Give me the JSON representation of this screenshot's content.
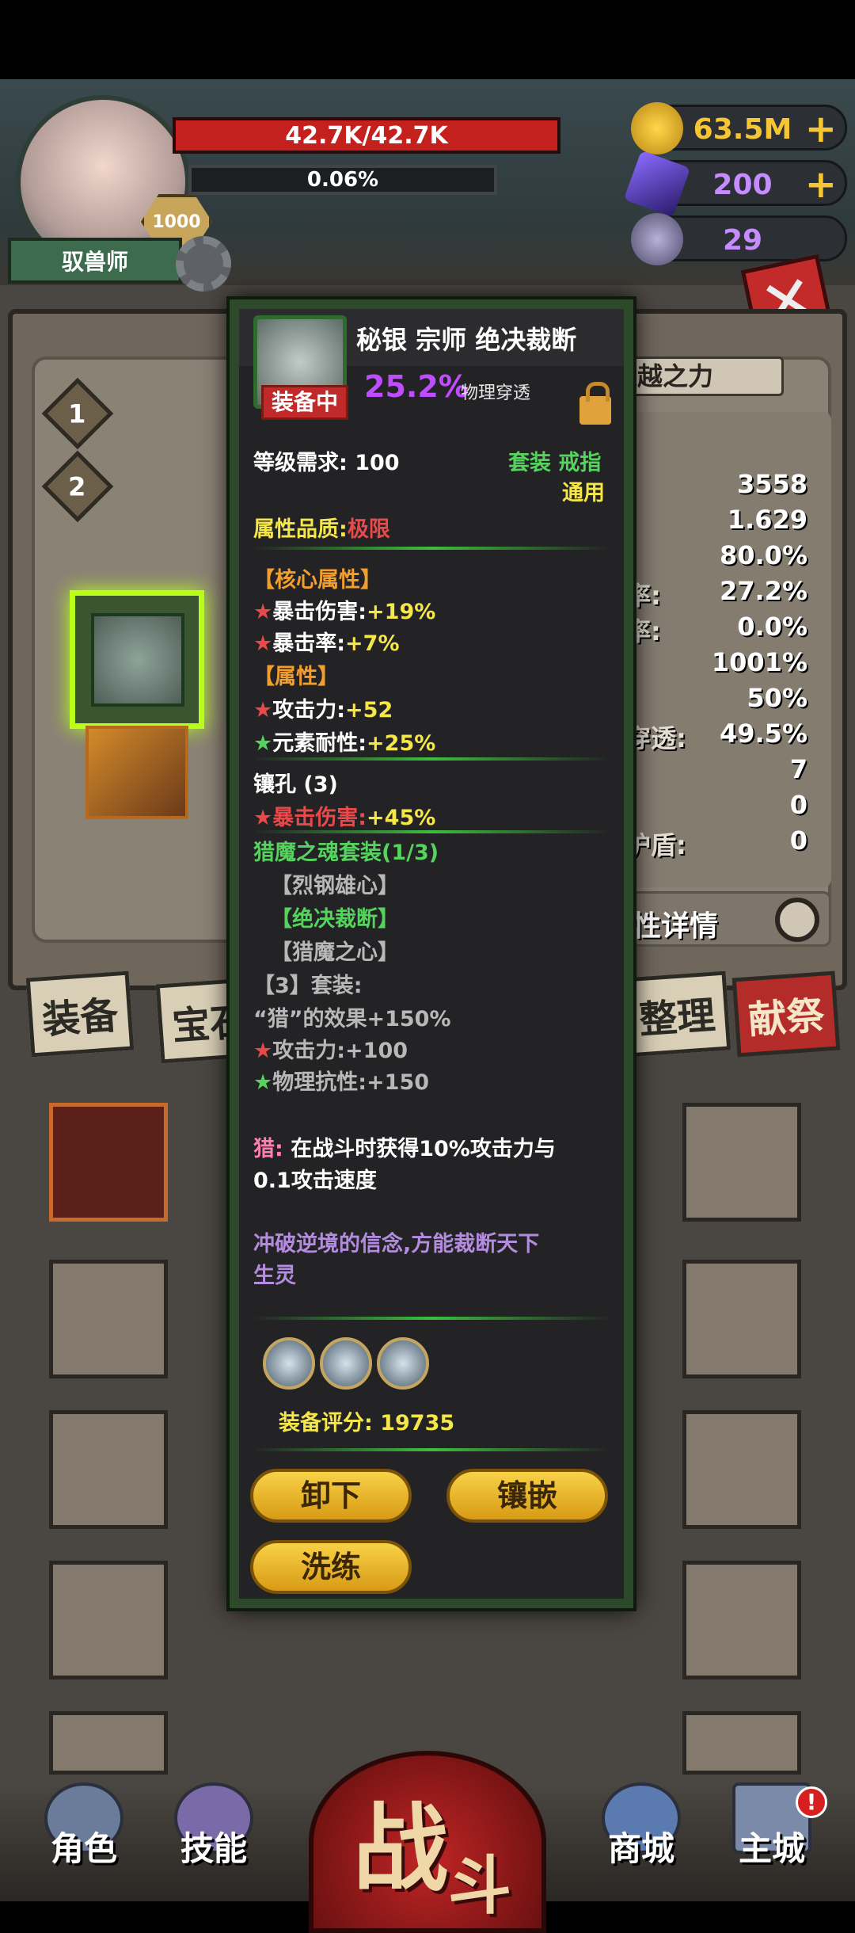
{
  "player": {
    "hp": "42.7K/42.7K",
    "exp": "0.06%",
    "level": "1000",
    "class_name": "驭兽师"
  },
  "resources": {
    "gold": "63.5M",
    "gems": "200",
    "tokens": "29"
  },
  "side_tabs": [
    "1",
    "2"
  ],
  "stats": {
    "header_label": "超越之力",
    "values": [
      "3558",
      "1.629",
      "80.0%",
      "27.2%",
      "0.0%",
      "1001%",
      "50%",
      "49.5%",
      "7",
      "0",
      "0"
    ],
    "partial_labels": [
      "率:",
      "率:",
      "穿透:",
      ":",
      ":",
      "护盾:"
    ],
    "details_button": "属性详情"
  },
  "tabs": {
    "equip": "装备",
    "treasure": "宝石",
    "sort": "整理",
    "sacrifice": "献祭"
  },
  "popup": {
    "title": "秘银 宗师 绝决裁断",
    "equipped_badge": "装备中",
    "percent": "25.2%",
    "percent_label": "物理穿透",
    "level_req_label": "等级需求:",
    "level_req_value": "100",
    "set_type": "套装 戒指",
    "set_usage": "通用",
    "quality_label": "属性品质:",
    "quality_value": "极限",
    "core_header": "【核心属性】",
    "core_1": "暴击伤害:",
    "core_1_val": "+19%",
    "core_2": "暴击率:",
    "core_2_val": "+7%",
    "attr_header": "【属性】",
    "attr_1": "攻击力:",
    "attr_1_val": "+52",
    "attr_2": "元素耐性:",
    "attr_2_val": "+25%",
    "socket_header": "镶孔 (3)",
    "socket_1": "暴击伤害:",
    "socket_1_val": "+45%",
    "set_name": "猎魔之魂套装(1/3)",
    "set_piece_1": "【烈钢雄心】",
    "set_piece_2": "【绝决裁断】",
    "set_piece_3": "【猎魔之心】",
    "set_bonus_header": "【3】套装:",
    "set_bonus_1": "“猎”的效果+150%",
    "set_bonus_2": "攻击力:",
    "set_bonus_2_val": "+100",
    "set_bonus_3": "物理抗性:",
    "set_bonus_3_val": "+150",
    "hunt_label": "猎:",
    "hunt_text_1": "在战斗时获得10%攻击力与",
    "hunt_text_2": "0.1攻击速度",
    "flavor_1": "冲破逆境的信念,方能裁断天下",
    "flavor_2": "生灵",
    "score_label": "装备评分:",
    "score_value": "19735",
    "btn_unequip": "卸下",
    "btn_inlay": "镶嵌",
    "btn_refine": "洗练",
    "star": "★"
  },
  "nav": {
    "role": "角色",
    "skills": "技能",
    "fight_1": "战",
    "fight_2": "斗",
    "shop": "商城",
    "city": "主城",
    "badge": "!"
  },
  "colors": {
    "hp_bar": "#c3201e",
    "quality_red": "#e64a4a",
    "percent_purple": "#c04cff",
    "popup_border": "#2c4a2a",
    "button_gold": "#f8d247"
  }
}
